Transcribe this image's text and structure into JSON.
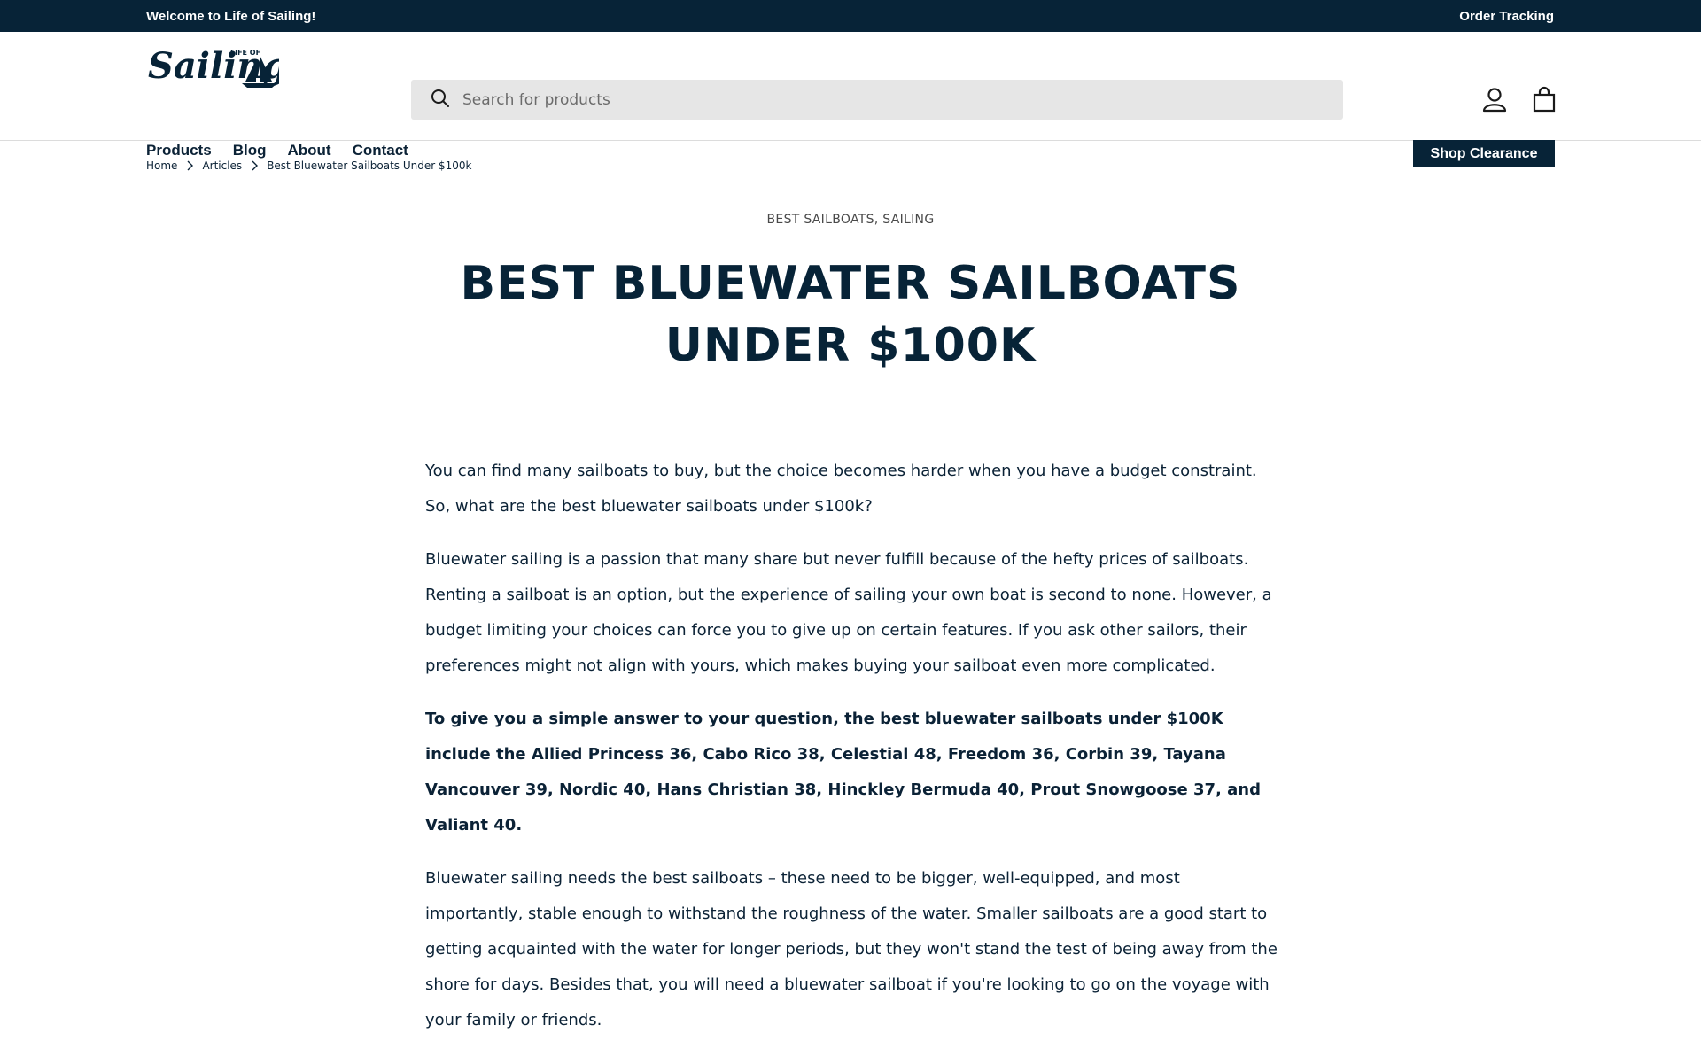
{
  "announcement": {
    "left_text": "Welcome to Life of Sailing!",
    "right_link": "Order Tracking"
  },
  "header": {
    "logo_text": "Sailing",
    "logo_small": "LIFE OF",
    "search_placeholder": "Search for products",
    "icons": [
      "search-icon",
      "account-icon",
      "cart-icon"
    ]
  },
  "nav": {
    "items": [
      "Products",
      "Blog",
      "About",
      "Contact"
    ],
    "clearance_button": "Shop Clearance"
  },
  "breadcrumb": {
    "items": [
      "Home",
      "Articles",
      "Best Bluewater Sailboats Under $100k"
    ]
  },
  "article": {
    "categories": "BEST SAILBOATS, SAILING",
    "title_line1": "BEST BLUEWATER SAILBOATS",
    "title_line2": "UNDER $100K",
    "paragraphs": [
      "You can find many sailboats to buy, but the choice becomes harder when you have a budget constraint. So, what are the best bluewater sailboats under $100k?",
      "Bluewater sailing is a passion that many share but never fulfill because of the hefty prices of sailboats. Renting a sailboat is an option, but the experience of sailing your own boat is second to none. However, a budget limiting your choices can force you to give up on certain features. If you ask other sailors, their preferences might not align with yours, which makes buying your sailboat even more complicated.",
      "To give you a simple answer to your question, the best bluewater sailboats under $100K include the Allied Princess 36, Cabo Rico 38, Celestial 48, Freedom 36, Corbin 39, Tayana Vancouver 39, Nordic 40, Hans Christian 38, Hinckley Bermuda 40, Prout Snowgoose 37, and Valiant 40.",
      "Bluewater sailing needs the best sailboats – these need to be bigger, well-equipped, and most importantly, stable enough to withstand the roughness of the water. Smaller sailboats are a good start to getting acquainted with the water for longer periods, but they won't stand the test of being away from the shore for days. Besides that, you will need a bluewater sailboat if you're looking to go on the voyage with your family or friends."
    ]
  },
  "colors": {
    "brand_navy": "#072337",
    "search_bg": "#e6e6e6"
  }
}
